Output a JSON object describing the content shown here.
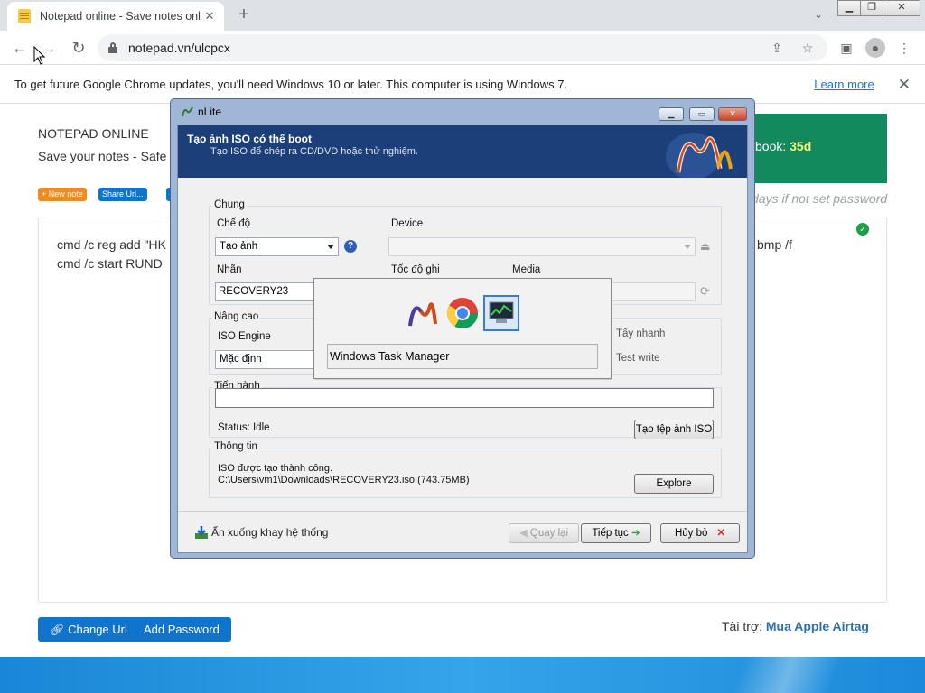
{
  "browser": {
    "tab_title": "Notepad online - Save notes onl",
    "tab_close": "✕",
    "new_tab": "+",
    "url": "notepad.vn/ulcpcx",
    "tabsearch": "⌄",
    "win_minimize": "▁",
    "win_restore": "❐",
    "win_close": "✕",
    "infobar": {
      "message": "To get future Google Chrome updates, you'll need Windows 10 or later. This computer is using Windows 7.",
      "link": "Learn more",
      "close": "✕"
    }
  },
  "page": {
    "brand": "NOTEPAD ONLINE",
    "tagline": "Save your notes - Safe",
    "new_note": "+ New note",
    "share_url": "Share Url...",
    "promo_text": "book: ",
    "promo_days": "35d",
    "expire_note": "days if not set password",
    "editor_lines": [
      {
        "left": "cmd /c reg add \"HK",
        "right": "bmp /f"
      },
      {
        "left": "cmd /c start RUND",
        "right": ""
      }
    ],
    "change_url": "Change Url",
    "add_password": "Add Password",
    "sponsor_label": "Tài trợ: ",
    "sponsor_link": "Mua Apple Airtag"
  },
  "dialog": {
    "title": "nLite",
    "banner_title": "Tạo ảnh ISO có thể boot",
    "banner_sub": "Tạo ISO để chép ra CD/DVD hoặc thử nghiệm.",
    "group_general": "Chung",
    "mode_label": "Chế độ",
    "mode_value": "Tạo ảnh",
    "device_label": "Device",
    "label_label": "Nhãn",
    "label_value": "RECOVERY23",
    "speed_label": "Tốc độ ghi",
    "media_label": "Media",
    "group_advanced": "Nâng cao",
    "engine_label": "ISO Engine",
    "engine_value": "Mặc định",
    "quick_erase": "Tẩy nhanh",
    "test_write": "Test write",
    "group_progress": "Tiến hành",
    "status": "Status: Idle",
    "make_iso": "Tạo tệp ảnh ISO",
    "group_info": "Thông tin",
    "info_line1": "ISO được tạo thành công.",
    "info_line2": "C:\\Users\\vm1\\Downloads\\RECOVERY23.iso (743.75MB)",
    "explore": "Explore",
    "tray": "Ẩn xuống khay hệ thống",
    "back": "Quay lại",
    "next": "Tiếp tục",
    "cancel": "Hủy bỏ"
  },
  "switcher": {
    "selected_label": "Windows Task Manager"
  }
}
